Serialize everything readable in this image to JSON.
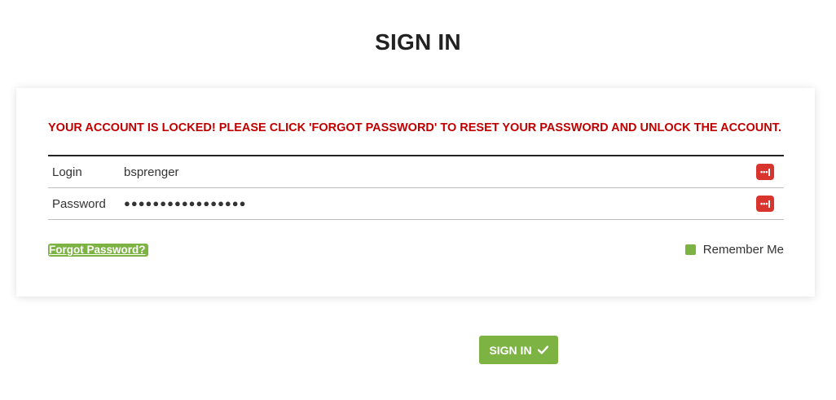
{
  "page": {
    "title": "SIGN IN"
  },
  "alert": {
    "message": "YOUR ACCOUNT IS LOCKED! PLEASE CLICK 'FORGOT PASSWORD' TO RESET YOUR PASSWORD AND UNLOCK THE ACCOUNT."
  },
  "form": {
    "login": {
      "label": "Login",
      "value": "bsprenger",
      "icon": "password-manager-icon"
    },
    "password": {
      "label": "Password",
      "value": "●●●●●●●●●●●●●●●●●",
      "icon": "password-manager-icon"
    }
  },
  "forgot_password": {
    "label": "Forgot Password?"
  },
  "remember_me": {
    "label": "Remember Me",
    "checked": true
  },
  "submit": {
    "label": "SIGN IN",
    "icon": "checkmark-icon"
  },
  "colors": {
    "accent_green": "#7cb342",
    "error_red": "#c00000",
    "password_manager_red": "#d8352f"
  }
}
